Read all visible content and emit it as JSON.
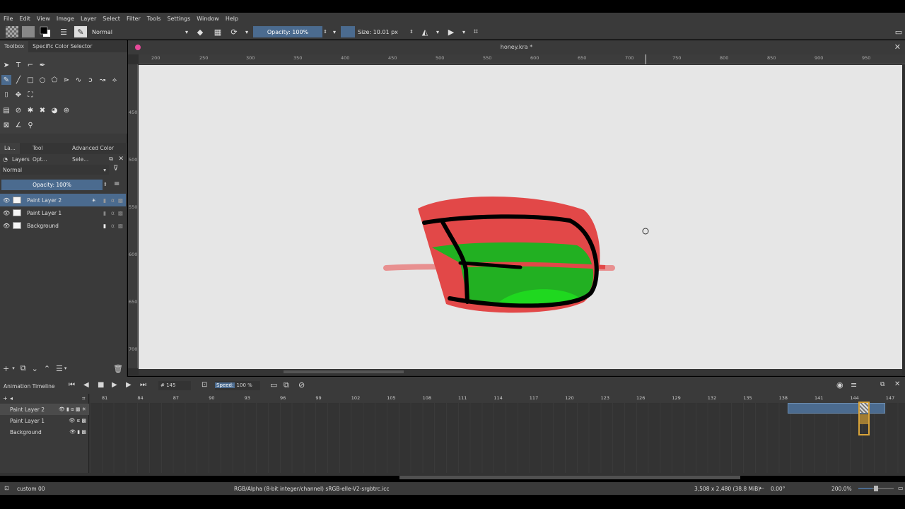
{
  "menu": [
    "File",
    "Edit",
    "View",
    "Image",
    "Layer",
    "Select",
    "Filter",
    "Tools",
    "Settings",
    "Window",
    "Help"
  ],
  "toolbar": {
    "blend_mode": "Normal",
    "opacity": "Opacity: 100%",
    "size": "Size: 10.01 px"
  },
  "dock_tabs_top": [
    "Toolbox",
    "Specific Color Selector"
  ],
  "dock_tabs_mid": [
    "La...",
    "Tool Opt...",
    "Advanced Color Sele..."
  ],
  "layers_panel": {
    "title": "Layers",
    "blend_mode": "Normal",
    "opacity": "Opacity:  100%",
    "layers": [
      "Paint Layer 2",
      "Paint Layer 1",
      "Background"
    ]
  },
  "document": {
    "title": "honey.kra *"
  },
  "ruler": {
    "h": [
      "200",
      "250",
      "300",
      "350",
      "400",
      "450",
      "500",
      "550",
      "600",
      "650",
      "700",
      "750",
      "800",
      "850",
      "900",
      "950"
    ],
    "v": [
      "450",
      "500",
      "550",
      "600",
      "650",
      "700"
    ]
  },
  "timeline": {
    "title": "Animation Timeline",
    "frame": "145",
    "speed_label": "Speed:",
    "speed_value": "100 %",
    "frame_numbers": [
      "81",
      "84",
      "87",
      "90",
      "93",
      "96",
      "99",
      "102",
      "105",
      "108",
      "111",
      "114",
      "117",
      "120",
      "123",
      "126",
      "129",
      "132",
      "135",
      "138",
      "141",
      "144",
      "147"
    ],
    "layers": [
      "Paint Layer 2",
      "Paint Layer 1",
      "Background"
    ]
  },
  "status": {
    "brush": "custom 00",
    "color_space": "RGB/Alpha (8-bit integer/channel)  sRGB-elle-V2-srgbtrc.icc",
    "dimensions": "3,508 x 2,480 (38.8 MiB)",
    "rotation": "0.00°",
    "zoom": "200.0%"
  },
  "colors": {
    "accent": "#4b6b8f",
    "red": "#e04848",
    "green": "#22b022",
    "keyframe": "#d8a33a"
  }
}
